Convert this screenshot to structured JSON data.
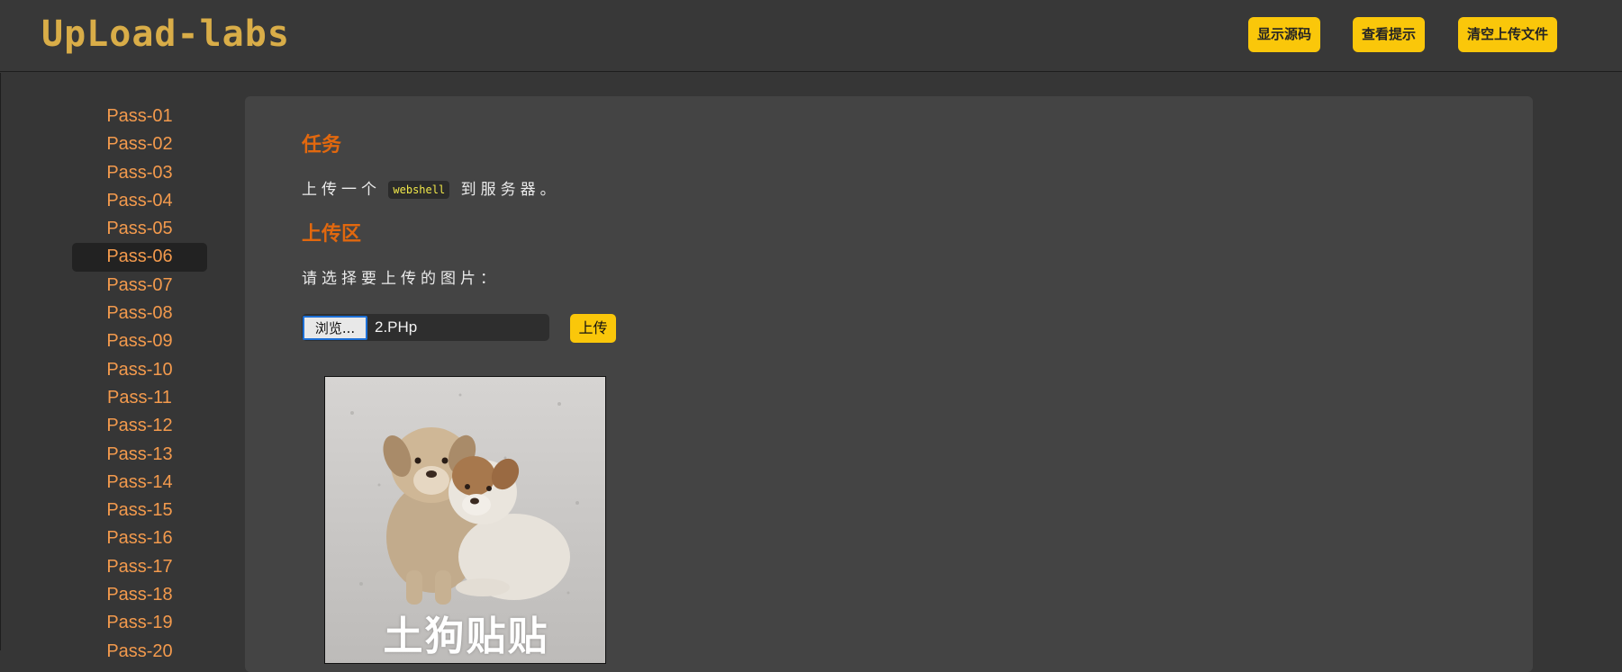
{
  "header": {
    "logo_text": "UpLoad-labs",
    "buttons": {
      "show_source": "显示源码",
      "show_hint": "查看提示",
      "clear_uploads": "清空上传文件"
    }
  },
  "sidebar": {
    "items": [
      {
        "label": "Pass-01"
      },
      {
        "label": "Pass-02"
      },
      {
        "label": "Pass-03"
      },
      {
        "label": "Pass-04"
      },
      {
        "label": "Pass-05"
      },
      {
        "label": "Pass-06",
        "active": true
      },
      {
        "label": "Pass-07"
      },
      {
        "label": "Pass-08"
      },
      {
        "label": "Pass-09"
      },
      {
        "label": "Pass-10"
      },
      {
        "label": "Pass-11"
      },
      {
        "label": "Pass-12"
      },
      {
        "label": "Pass-13"
      },
      {
        "label": "Pass-14"
      },
      {
        "label": "Pass-15"
      },
      {
        "label": "Pass-16"
      },
      {
        "label": "Pass-17"
      },
      {
        "label": "Pass-18"
      },
      {
        "label": "Pass-19"
      },
      {
        "label": "Pass-20"
      }
    ]
  },
  "main": {
    "task_heading": "任务",
    "task_text_before": "上传一个",
    "task_code": "webshell",
    "task_text_after": "到服务器。",
    "upload_heading": "上传区",
    "upload_prompt": "请选择要上传的图片：",
    "browse_label": "浏览...",
    "file_name": "2.PHp",
    "upload_label": "上传",
    "preview_caption": "土狗贴贴"
  },
  "colors": {
    "accent_button": "#fac70a",
    "heading": "#e2680e",
    "nav_link": "#f39a4d",
    "logo": "#d9ad48"
  }
}
